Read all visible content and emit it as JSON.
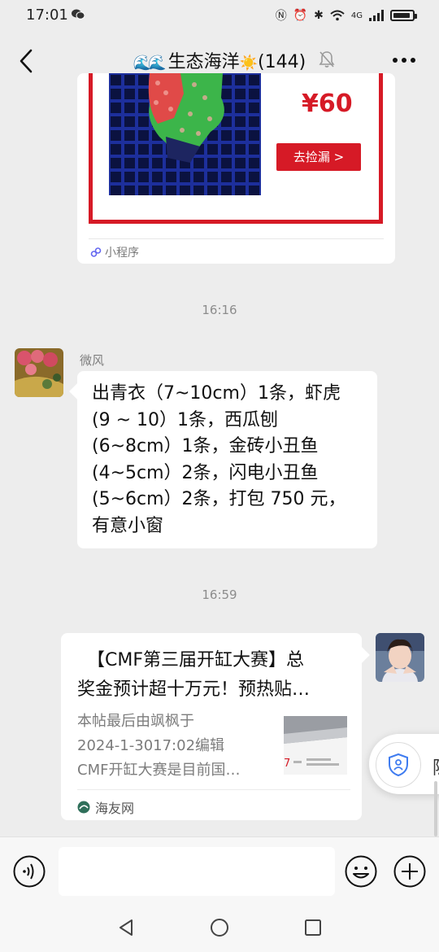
{
  "status_bar": {
    "time": "17:01",
    "network": "4G",
    "battery_level": 0.9
  },
  "header": {
    "group_title": "生态海洋",
    "member_count": "(144)",
    "title_waves": "🌊🌊",
    "title_sun": "☀️"
  },
  "mini_program_card": {
    "price": "¥60",
    "button_label": "去捡漏 >",
    "source_label": "小程序"
  },
  "messages": {
    "timestamp_1": "16:16",
    "incoming": {
      "sender": "微风",
      "lines": [
        "出青衣（7~10cm）1条，虾虎",
        "(9 ~ 10）1条，西瓜刨",
        "(6~8cm）1条，金砖小丑鱼",
        "(4~5cm）2条，闪电小丑鱼",
        "(5~6cm）2条，打包 750 元，",
        "有意小窗"
      ]
    },
    "timestamp_2": "16:59",
    "link_card": {
      "title_line1": "【CMF第三届开缸大赛】总",
      "title_line2": "奖金预计超十万元！预热贴…",
      "desc_line1": "本帖最后由飒枫于",
      "desc_line2": "2024-1-3017:02编辑",
      "desc_line3": "CMF开缸大赛是目前国…",
      "source": "海友网"
    }
  },
  "floating_widget": {
    "cut_text": "隐"
  },
  "colors": {
    "accent_red": "#d61a26",
    "chat_background": "#ededed"
  }
}
